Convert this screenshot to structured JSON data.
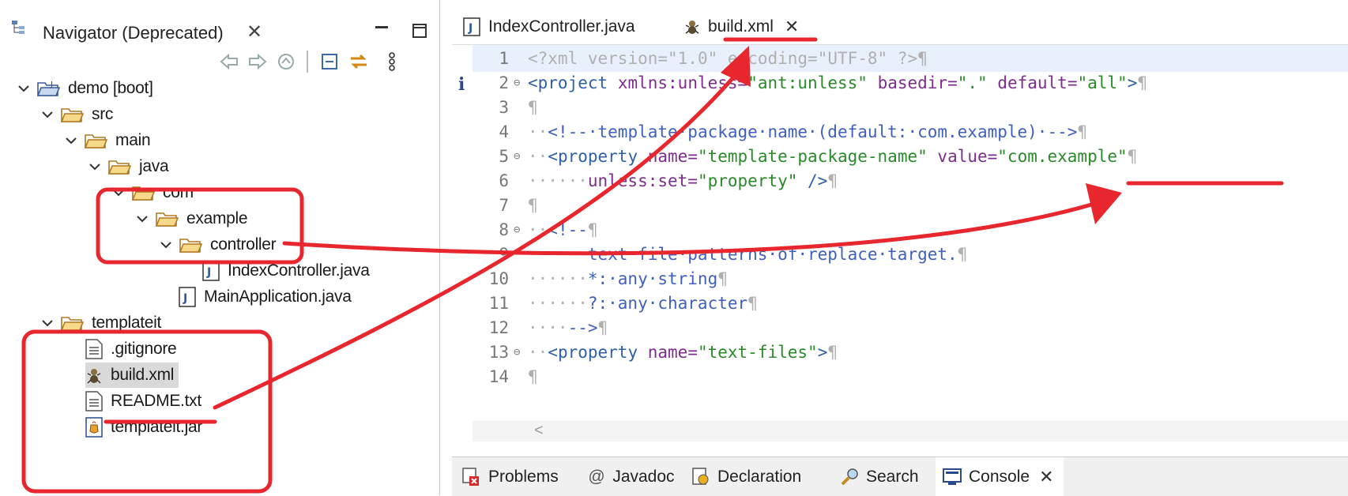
{
  "navigator": {
    "title": "Navigator (Deprecated)",
    "close_glyph": "✕",
    "toolbar_icons": [
      "back-arrow-icon",
      "forward-arrow-icon",
      "up-folder-icon",
      "collapse-all-icon",
      "link-editor-icon",
      "view-menu-icon"
    ],
    "tree": [
      {
        "label": "demo [boot]",
        "icon": "project-folder-icon",
        "level": 0,
        "expanded": true
      },
      {
        "label": "src",
        "icon": "folder-icon",
        "level": 1,
        "expanded": true
      },
      {
        "label": "main",
        "icon": "folder-icon",
        "level": 2,
        "expanded": true
      },
      {
        "label": "java",
        "icon": "folder-icon",
        "level": 3,
        "expanded": true
      },
      {
        "label": "com",
        "icon": "folder-icon",
        "level": 4,
        "expanded": true
      },
      {
        "label": "example",
        "icon": "folder-icon",
        "level": 5,
        "expanded": true
      },
      {
        "label": "controller",
        "icon": "folder-icon",
        "level": 6,
        "expanded": true
      },
      {
        "label": "IndexController.java",
        "icon": "java-file-icon",
        "level": 7
      },
      {
        "label": "MainApplication.java",
        "icon": "java-file-icon",
        "level": 6
      },
      {
        "label": "templateit",
        "icon": "folder-icon",
        "level": 1,
        "expanded": true
      },
      {
        "label": ".gitignore",
        "icon": "text-file-icon",
        "level": 2
      },
      {
        "label": "build.xml",
        "icon": "ant-file-icon",
        "level": 2,
        "selected": true
      },
      {
        "label": "README.txt",
        "icon": "text-file-icon",
        "level": 2
      },
      {
        "label": "templateit.jar",
        "icon": "jar-file-icon",
        "level": 2
      }
    ]
  },
  "editor": {
    "tabs": [
      {
        "label": "IndexController.java",
        "icon": "java-file-icon"
      },
      {
        "label": "build.xml",
        "icon": "ant-file-icon",
        "active": true,
        "close": "✕"
      }
    ],
    "lines": [
      {
        "n": "1",
        "fold": ""
      },
      {
        "n": "2",
        "fold": "⊖"
      },
      {
        "n": "3",
        "fold": ""
      },
      {
        "n": "4",
        "fold": ""
      },
      {
        "n": "5",
        "fold": "⊖"
      },
      {
        "n": "6",
        "fold": ""
      },
      {
        "n": "7",
        "fold": ""
      },
      {
        "n": "8",
        "fold": "⊖"
      },
      {
        "n": "9",
        "fold": ""
      },
      {
        "n": "10",
        "fold": ""
      },
      {
        "n": "11",
        "fold": ""
      },
      {
        "n": "12",
        "fold": ""
      },
      {
        "n": "13",
        "fold": "⊖"
      },
      {
        "n": "14",
        "fold": ""
      }
    ],
    "code": {
      "l1": [
        "<?xml",
        " ",
        "version=\"1.0\"",
        " ",
        "encoding=\"UTF-8\"",
        " ",
        "?>",
        "¶"
      ],
      "l2": [
        "<project",
        " ",
        "xmlns:unless=",
        "\"ant:unless\"",
        " ",
        "basedir=",
        "\".\"",
        " ",
        "default=",
        "\"all\"",
        ">",
        "¶"
      ],
      "l3": [
        "¶"
      ],
      "l4": [
        "··",
        "<!--·template·package·name·(default:·com.example)·-->",
        "¶"
      ],
      "l5": [
        "··",
        "<property",
        " ",
        "name=",
        "\"template-package-name\"",
        " ",
        "value=",
        "\"com.example\"",
        "¶"
      ],
      "l6": [
        "······",
        "unless:set=",
        "\"property\"",
        " ",
        "/>",
        "¶"
      ],
      "l7": [
        "¶"
      ],
      "l8": [
        "··",
        "<!--",
        "¶"
      ],
      "l9": [
        "······",
        "text·file·patterns·of·replace·target.",
        "¶"
      ],
      "l10": [
        "······",
        "*:·any·string",
        "¶"
      ],
      "l11": [
        "······",
        "?:·any·character",
        "¶"
      ],
      "l12": [
        "····",
        "-->",
        "¶"
      ],
      "l13": [
        "··",
        "<property",
        " ",
        "name=",
        "\"text-files\"",
        ">",
        "¶"
      ],
      "l14": [
        "¶"
      ]
    },
    "info_marker": "i",
    "scroll_left": "<"
  },
  "bottom_tabs": [
    {
      "label": "Problems",
      "icon": "problems-icon"
    },
    {
      "label": "Javadoc",
      "icon": "at-icon"
    },
    {
      "label": "Declaration",
      "icon": "declaration-icon"
    },
    {
      "label": "Search",
      "icon": "search-icon"
    },
    {
      "label": "Console",
      "icon": "console-icon",
      "close": "✕"
    }
  ],
  "colors": {
    "annotation": "#e8262d",
    "tag": "#2f5fa8",
    "attr": "#7d2d8e",
    "string": "#2a8a2a"
  }
}
